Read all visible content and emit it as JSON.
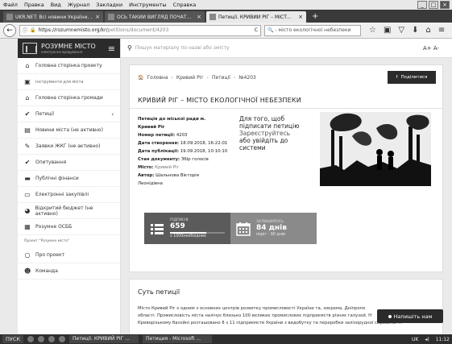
{
  "menubar": [
    "Файл",
    "Правка",
    "Вид",
    "Журнал",
    "Закладки",
    "Инструменты",
    "Справка"
  ],
  "tabs": [
    {
      "title": "UKR.NET: Всі новини України, ...",
      "active": false
    },
    {
      "title": "ОСЬ ТАКИЙ ВИГЛЯД ПОЧАТ...",
      "active": false
    },
    {
      "title": "Петиції. КРИВИЙ РІГ – МІСТ...",
      "active": true
    }
  ],
  "url": {
    "base": "https://rozumnemisto.org/kr/",
    "path": "petitions/document/4203"
  },
  "browser_search": "- місто екологічної небезпеки",
  "site": {
    "logo": "РОЗУМНЕ МІСТО",
    "logo_sub": "електронне врядування",
    "search_placeholder": "Пошук матеріалу по назві або змісту",
    "font_size_ctrl": "A+ A-"
  },
  "sidebar": {
    "items": [
      {
        "label": "Головна сторінка проекту",
        "icon": "home-icon",
        "small": false
      },
      {
        "label": "Інструменти для міста",
        "icon": "tools-icon",
        "small": true
      },
      {
        "label": "Головна сторінка громади",
        "icon": "home-icon",
        "small": false
      },
      {
        "label": "Петиції",
        "icon": "check-icon",
        "small": false,
        "chevron": true
      },
      {
        "label": "Новини міста (не активно)",
        "icon": "news-icon",
        "small": false
      },
      {
        "label": "Заявки ЖКГ (не активно)",
        "icon": "wrench-icon",
        "small": false
      },
      {
        "label": "Опитування",
        "icon": "check-icon",
        "small": false
      },
      {
        "label": "Публічні фінанси",
        "icon": "bank-icon",
        "small": false
      },
      {
        "label": "Електронні закупівлі",
        "icon": "card-icon",
        "small": false
      },
      {
        "label": "Відкритий бюджет (не активно)",
        "icon": "pie-icon",
        "small": false
      },
      {
        "label": "Розумне ОСББ",
        "icon": "building-icon",
        "small": false
      }
    ],
    "section": "Проект \"Розумне місто\"",
    "items2": [
      {
        "label": "Про проект",
        "icon": "info-icon"
      },
      {
        "label": "Команда",
        "icon": "team-icon"
      }
    ]
  },
  "breadcrumbs": [
    "Головна",
    "Кривий Ріг",
    "Петиції",
    "№4203"
  ],
  "share_label": "Поділитися",
  "petition": {
    "title": "КРИВИЙ РІГ – МІСТО ЕКОЛОГІЧНОЇ НЕБЕЗПЕКИ",
    "addressee_1": "Петиція до міської ради м.",
    "addressee_2": "Кривий Ріг",
    "number_label": "Номер петиції:",
    "number": "4203",
    "created_label": "Дата створення:",
    "created": "18.09.2018, 16:22:01",
    "published_label": "Дата публікації:",
    "published": "19.09.2018, 10:10:10",
    "status_label": "Стан документу:",
    "status": "Збір голосів",
    "city_label": "Місто:",
    "city": "Кривий Ріг",
    "author_label": "Автор:",
    "author_1": "Шальнова Вікторія",
    "author_2": "Леонідівна"
  },
  "sign_box": {
    "line1": "Для того, щоб",
    "line2": "підписати петицію",
    "link": "Зареєструйтесь",
    "line3": "або увійдіть до",
    "line4": "системи"
  },
  "stats": {
    "signatures_label": "ПІДПИСІВ",
    "signatures": "659",
    "signatures_needed": "з 1000необхідних",
    "signatures_progress": 0.659,
    "remaining_label": "ЗАЛИШИЛОСЬ",
    "remaining": "84 днів",
    "term": "поріг - 90 днів"
  },
  "essence": {
    "title": "Суть петиції",
    "line1": "Місто Кривий Ріг є одним з основних центрів розвитку промисловості України та, зокрема, Дніпропе",
    "line2": "області. Промисловість міста налічує близько 100 великих промислових підприємств різних галузей. Н",
    "line3": "Криворізькому басейні розташовано 8 з 11 підприємств України з видобутку та переробки залізорудної сировини. А"
  },
  "chat_label": "Напишіть нам",
  "taskbar": {
    "start": "ПУСК",
    "apps": [
      "Петиції. КРИВИЙ РІГ ...",
      "Петиция - Microsoft ..."
    ],
    "lang": "UK",
    "time": "11:12"
  }
}
